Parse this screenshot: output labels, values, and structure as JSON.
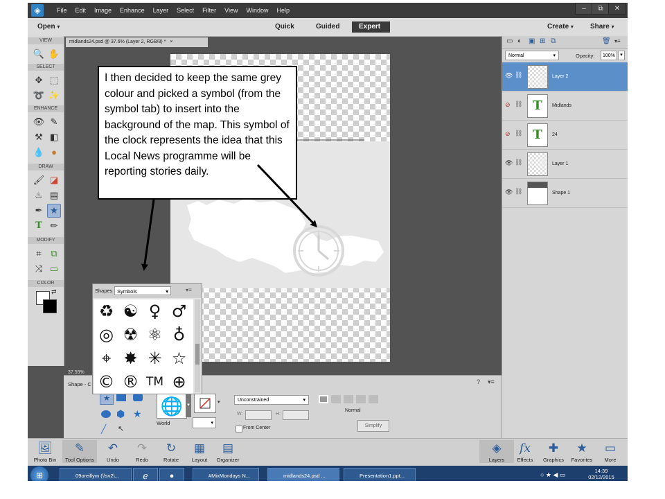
{
  "menu": {
    "items": [
      "File",
      "Edit",
      "Image",
      "Enhance",
      "Layer",
      "Select",
      "Filter",
      "View",
      "Window",
      "Help"
    ],
    "window_controls": [
      "–",
      "⧉",
      "✕"
    ]
  },
  "modebar": {
    "open_label": "Open",
    "modes": [
      "Quick",
      "Guided",
      "Expert"
    ],
    "create_label": "Create",
    "share_label": "Share"
  },
  "toolbox": {
    "sections": [
      "VIEW",
      "SELECT",
      "ENHANCE",
      "DRAW",
      "MODIFY",
      "COLOR"
    ]
  },
  "document": {
    "tab_title": "midlands24.psd @ 37.6% (Layer 2, RGB/8) *",
    "zoom": "37.59%"
  },
  "shapes_popup": {
    "label": "Shapes",
    "category": "Symbols",
    "symbols": [
      [
        "♻",
        "☯",
        "♀",
        "♂"
      ],
      [
        "◎",
        "☢",
        "⚛",
        "♁"
      ],
      [
        "⌖",
        "✸",
        "✳",
        "☆"
      ],
      [
        "©",
        "®",
        "TM",
        "⊕"
      ]
    ]
  },
  "tool_options": {
    "tool_label": "Shape - C",
    "shape_name": "World",
    "constraint": "Unconstrained",
    "w_label": "W:",
    "h_label": "H:",
    "from_center_label": "From Center",
    "blend_label": "Normal",
    "simplify_label": "Simplify"
  },
  "layers_panel": {
    "blend_mode": "Normal",
    "opacity_label": "Opacity:",
    "opacity_value": "100%",
    "layers": [
      {
        "name": "Layer 2",
        "type": "image",
        "visible": true,
        "selected": true
      },
      {
        "name": "Midlands",
        "type": "text",
        "visible": false,
        "selected": false
      },
      {
        "name": "24",
        "type": "text",
        "visible": false,
        "selected": false
      },
      {
        "name": "Layer 1",
        "type": "image",
        "visible": true,
        "selected": false
      },
      {
        "name": "Shape 1",
        "type": "shape",
        "visible": true,
        "selected": false
      }
    ]
  },
  "bottom_bin": {
    "left": [
      "Photo Bin",
      "Tool Options",
      "Undo",
      "Redo",
      "Rotate",
      "Layout",
      "Organizer"
    ],
    "right": [
      "Layers",
      "Effects",
      "Graphics",
      "Favorites",
      "More"
    ]
  },
  "taskbar": {
    "tasks": [
      "09oreillym (\\\\sv2\\...",
      "",
      "",
      "#MixMondays N...",
      "midlands24.psd ...",
      "Presentation1.ppt..."
    ],
    "time": "14:39",
    "date": "02/12/2015"
  },
  "annotation": {
    "text": "I then decided to keep the same grey colour and picked a symbol (from the symbol tab) to insert into the background of the map. This symbol of the clock represents the idea that this Local News programme will be reporting stories daily."
  },
  "colors": {
    "accent": "#5b8fc9",
    "app_bg": "#535353",
    "taskbar": "#1c3f6e"
  }
}
